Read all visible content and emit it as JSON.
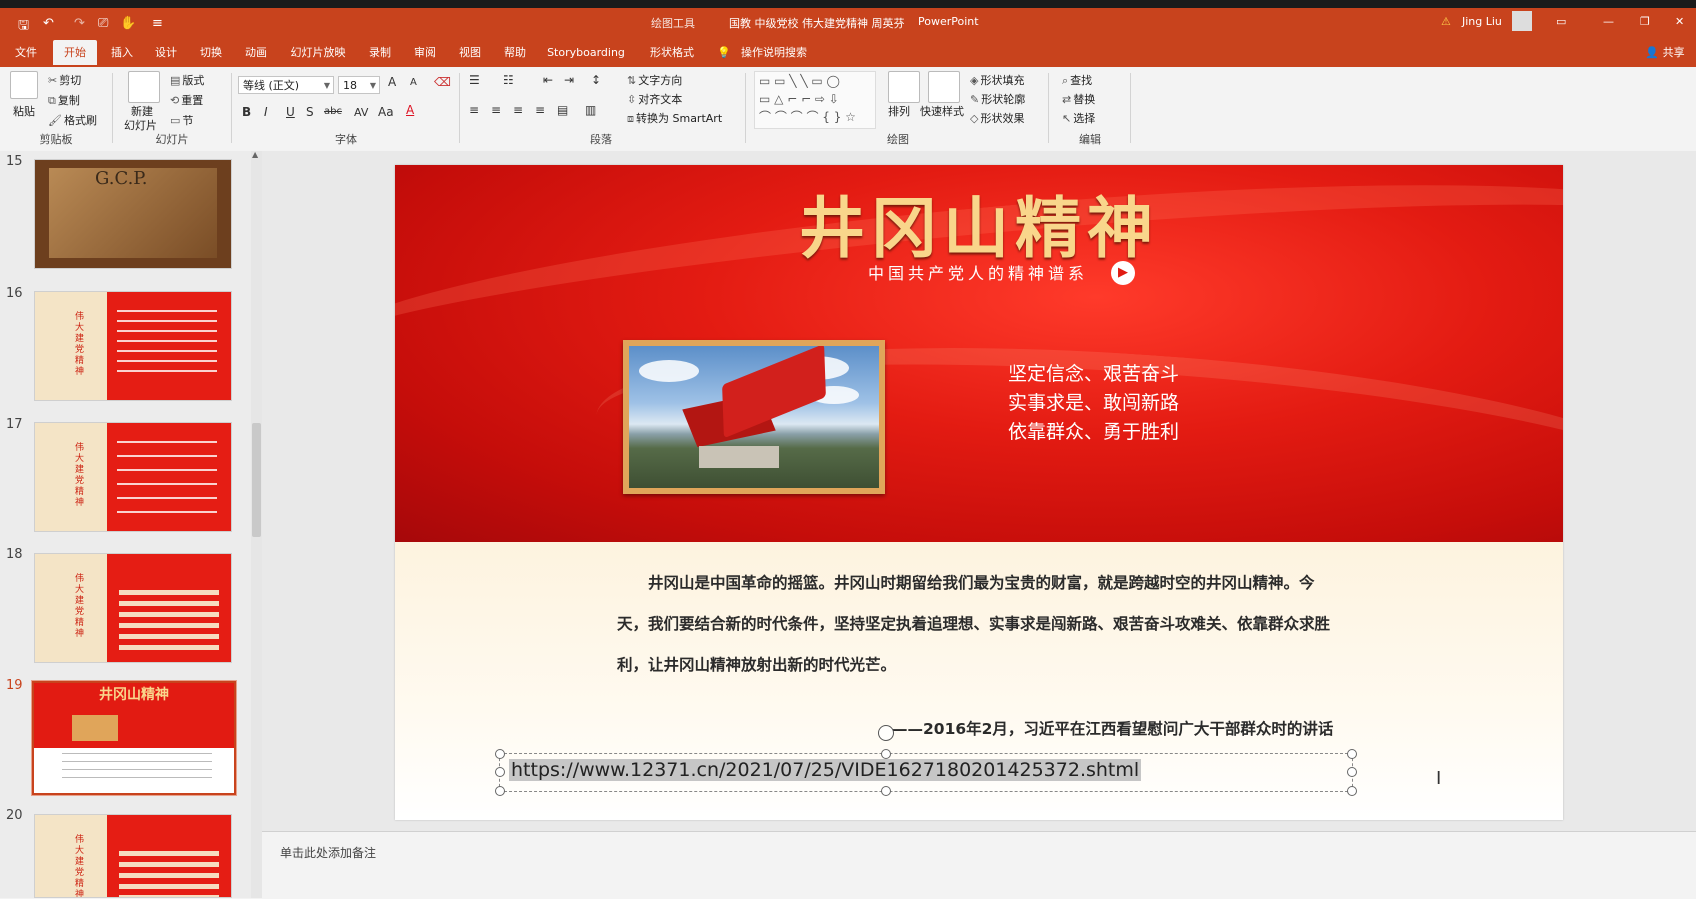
{
  "titlebar": {
    "context_tab": "绘图工具",
    "document": "国教 中级党校 伟大建党精神 周英芬",
    "app": "PowerPoint",
    "user": "Jing Liu"
  },
  "tabs": [
    "文件",
    "开始",
    "插入",
    "设计",
    "切换",
    "动画",
    "幻灯片放映",
    "录制",
    "审阅",
    "视图",
    "帮助",
    "Storyboarding",
    "形状格式"
  ],
  "search_hint": "操作说明搜索",
  "share": "共享",
  "ribbon": {
    "clipboard": {
      "paste": "粘贴",
      "cut": "剪切",
      "copy": "复制",
      "format_painter": "格式刷",
      "label": "剪贴板"
    },
    "slides": {
      "new_slide_l1": "新建",
      "new_slide_l2": "幻灯片",
      "layout": "版式",
      "reset": "重置",
      "section": "节",
      "label": "幻灯片"
    },
    "font": {
      "name": "等线 (正文)",
      "size": "18",
      "label": "字体",
      "bold": "B",
      "italic": "I",
      "underline": "U",
      "strike": "S",
      "spacing": "abc",
      "case": "Aa",
      "color": "A",
      "grow": "A",
      "shrink": "A"
    },
    "paragraph": {
      "text_direction": "文字方向",
      "align_text": "对齐文本",
      "smartart": "转换为 SmartArt",
      "label": "段落"
    },
    "drawing": {
      "arrange": "排列",
      "quick_styles": "快速样式",
      "fill": "形状填充",
      "outline": "形状轮廓",
      "effects": "形状效果",
      "label": "绘图"
    },
    "editing": {
      "find": "查找",
      "replace": "替换",
      "select": "选择",
      "label": "编辑"
    }
  },
  "thumbnails": [
    {
      "num": "15",
      "kind": "photo",
      "text": "G.C.P."
    },
    {
      "num": "16",
      "kind": "text",
      "side": "精神之源",
      "title": "伟大建党精神"
    },
    {
      "num": "17",
      "kind": "text",
      "side": "精神之源",
      "title": "中国共产党人的精神谱系"
    },
    {
      "num": "18",
      "kind": "table",
      "side": "精神之源",
      "title": "新民主主义革命时期"
    },
    {
      "num": "19",
      "kind": "selected",
      "title": "井冈山精神"
    },
    {
      "num": "20",
      "kind": "table",
      "side": "精神之源",
      "title": "社会主义革命和建设时期"
    }
  ],
  "slide": {
    "title": "井冈山精神",
    "subtitle": "中国共产党人的精神谱系",
    "slogans": [
      "坚定信念、艰苦奋斗",
      "实事求是、敢闯新路",
      "依靠群众、勇于胜利"
    ],
    "paragraph": "井冈山是中国革命的摇篮。井冈山时期留给我们最为宝贵的财富，就是跨越时空的井冈山精神。今天，我们要结合新的时代条件，坚持坚定执着追理想、实事求是闯新路、艰苦奋斗攻难关、依靠群众求胜利，让井冈山精神放射出新的时代光芒。",
    "quote": "——2016年2月，习近平在江西看望慰问广大干部群众时的讲话",
    "url": "https://www.12371.cn/2021/07/25/VIDE1627180201425372.shtml"
  },
  "notes_placeholder": "单击此处添加备注",
  "colors": {
    "accent": "#c8431d",
    "slide_red": "#e31b12",
    "gold": "#f9d68b"
  }
}
